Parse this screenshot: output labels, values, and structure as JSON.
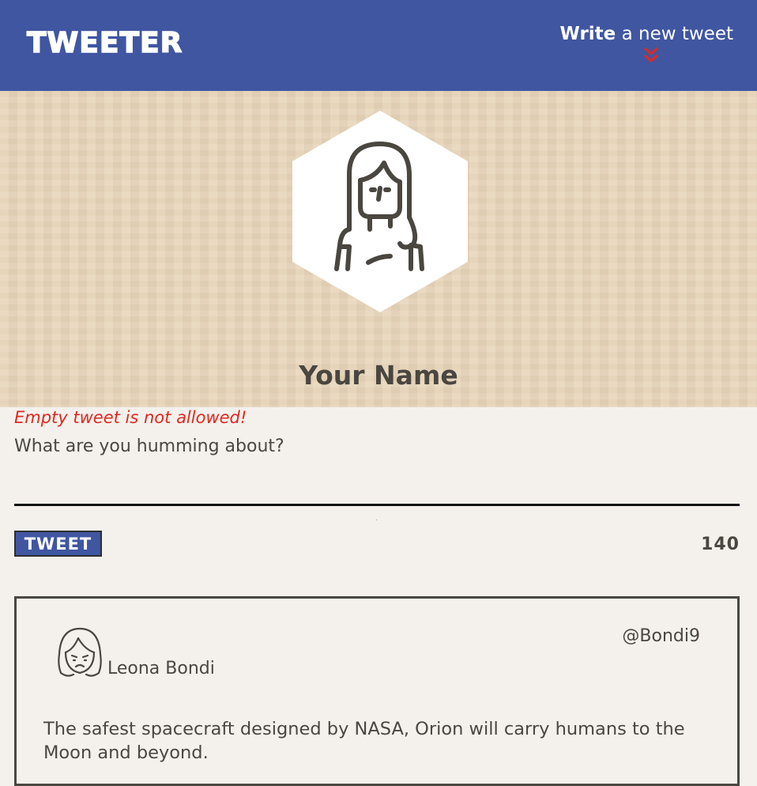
{
  "header": {
    "logo": "TWEETER",
    "compose_toggle_bold": "Write",
    "compose_toggle_rest": " a new tweet",
    "toggle_icon": "double-chevron-down-icon"
  },
  "profile": {
    "avatar_icon": "woman-avatar-icon",
    "name": "Your Name"
  },
  "composer": {
    "error": "Empty tweet is not allowed!",
    "placeholder": "What are you humming about?",
    "button_label": "TWEET",
    "counter": "140"
  },
  "tweets": [
    {
      "avatar_icon": "frowning-woman-avatar-icon",
      "author": "Leona Bondi",
      "handle": "@Bondi9",
      "text": "The safest spacecraft designed by NASA, Orion will carry humans to the Moon and beyond."
    }
  ],
  "colors": {
    "nav": "#4056a1",
    "hero": "#e9d6bb",
    "body": "#f4f1ec",
    "error": "#e0281f",
    "text": "#4a4640"
  }
}
